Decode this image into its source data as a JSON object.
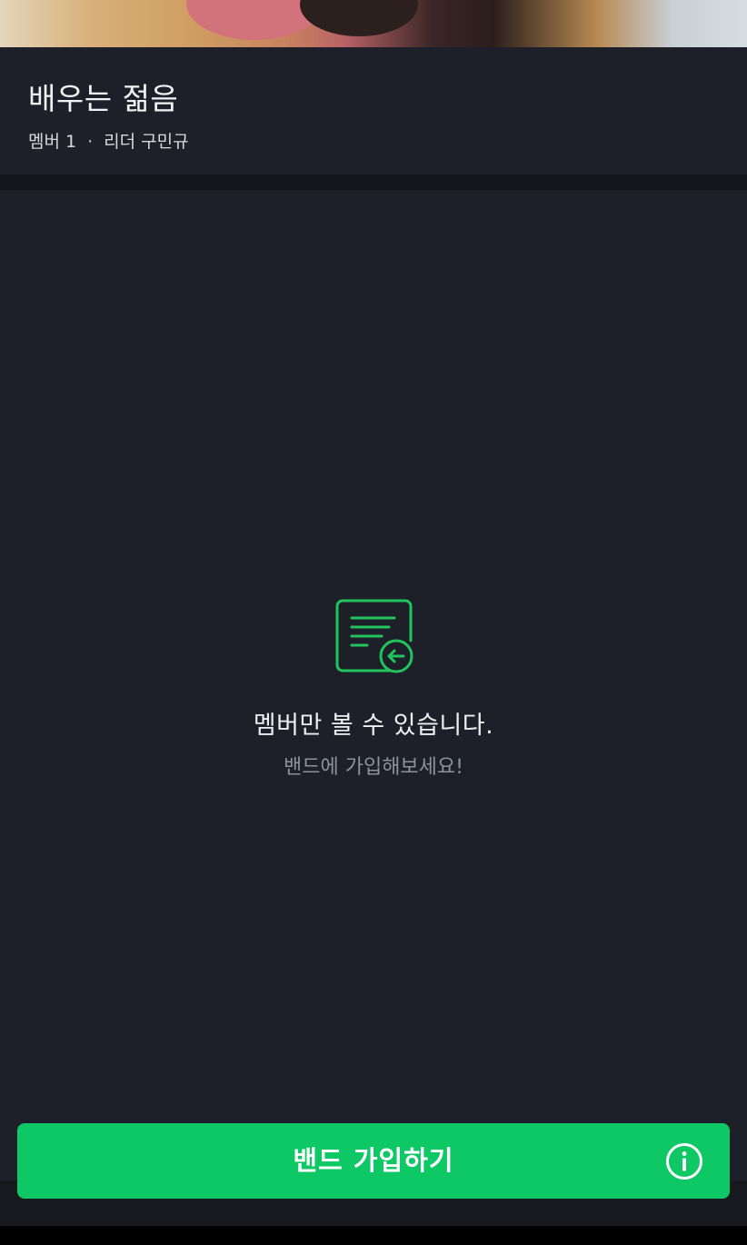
{
  "band": {
    "name": "배우는 젊음",
    "member_label": "멤버 1",
    "separator": "·",
    "leader_label": "리더 구민규"
  },
  "notice": {
    "icon": "document-arrow-icon",
    "title": "멤버만 볼 수 있습니다.",
    "subtitle": "밴드에 가입해보세요!"
  },
  "join_button": {
    "label": "밴드 가입하기",
    "info_icon": "info-circle-icon"
  },
  "colors": {
    "accent": "#0ec865",
    "background": "#1d2029",
    "icon_green": "#21c35c"
  }
}
